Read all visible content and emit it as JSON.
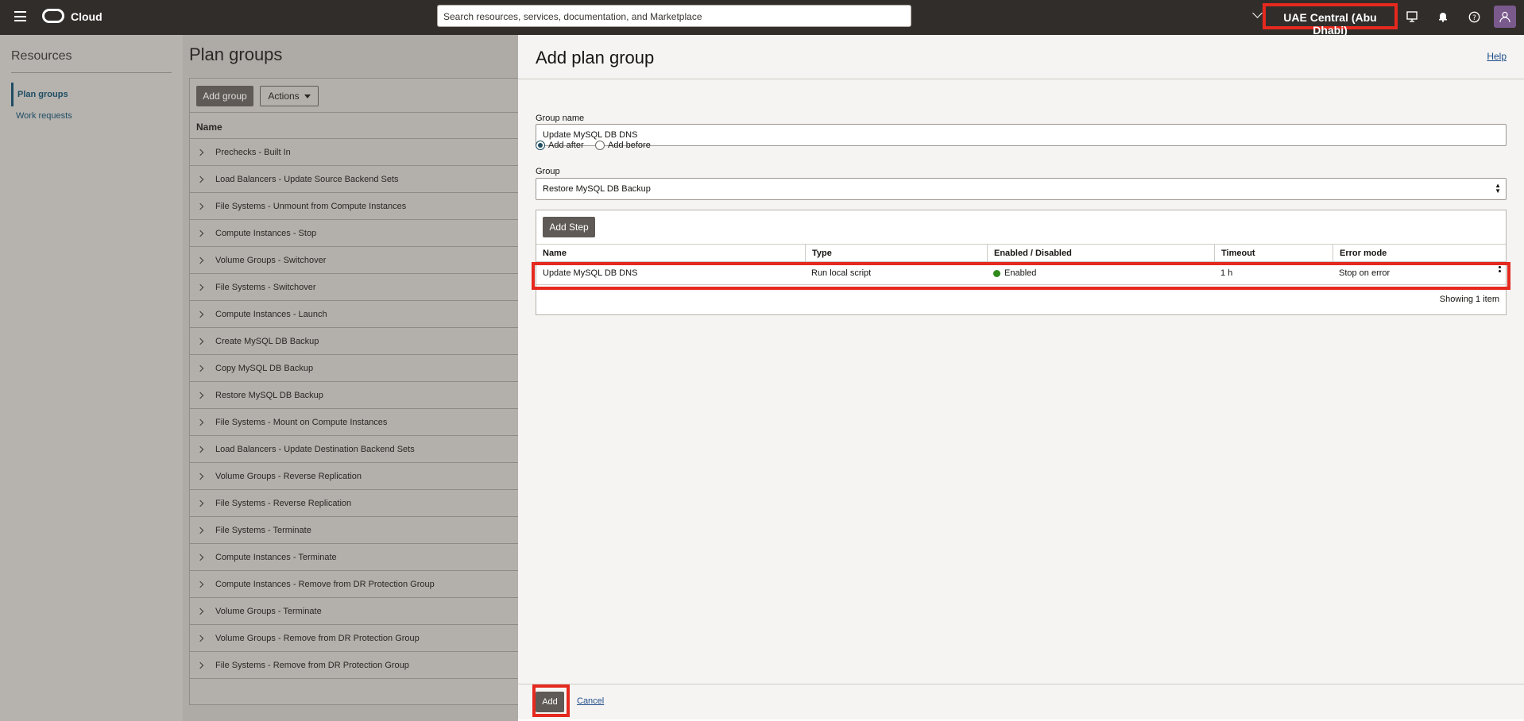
{
  "header": {
    "brand": "Cloud",
    "search_placeholder": "Search resources, services, documentation, and Marketplace",
    "region": "UAE Central (Abu Dhabi)",
    "icons": [
      "hamburger-icon",
      "cloud-logo-icon",
      "chevron-down-icon",
      "developer-tools-icon",
      "bell-icon",
      "help-icon",
      "user-avatar-icon"
    ]
  },
  "resources": {
    "title": "Resources",
    "items": [
      "Plan groups",
      "Work requests"
    ]
  },
  "plan_groups": {
    "title": "Plan groups",
    "add_label": "Add group",
    "actions_label": "Actions",
    "column": "Name",
    "rows": [
      "Prechecks - Built In",
      "Load Balancers - Update Source Backend Sets",
      "File Systems - Unmount from Compute Instances",
      "Compute Instances - Stop",
      "Volume Groups - Switchover",
      "File Systems - Switchover",
      "Compute Instances - Launch",
      "Create MySQL DB Backup",
      "Copy MySQL DB Backup",
      "Restore MySQL DB Backup",
      "File Systems - Mount on Compute Instances",
      "Load Balancers - Update Destination Backend Sets",
      "Volume Groups - Reverse Replication",
      "File Systems - Reverse Replication",
      "File Systems - Terminate",
      "Compute Instances - Terminate",
      "Compute Instances - Remove from DR Protection Group",
      "Volume Groups - Terminate",
      "Volume Groups - Remove from DR Protection Group",
      "File Systems - Remove from DR Protection Group"
    ]
  },
  "drawer": {
    "title": "Add plan group",
    "help": "Help",
    "group_name_label": "Group name",
    "group_name_value": "Update MySQL DB DNS",
    "radio_after": "Add after",
    "radio_before": "Add before",
    "group_label": "Group",
    "group_value": "Restore MySQL DB Backup",
    "add_step": "Add Step",
    "columns": [
      "Name",
      "Type",
      "Enabled / Disabled",
      "Timeout",
      "Error mode"
    ],
    "step": {
      "name": "Update MySQL DB DNS",
      "type": "Run local script",
      "status": "Enabled",
      "timeout": "1 h",
      "error_mode": "Stop on error"
    },
    "showing": "Showing 1 item",
    "add_button": "Add",
    "cancel": "Cancel"
  },
  "colors": {
    "header_bg": "#312d2a",
    "highlight": "#e5291f",
    "link": "#1f4d8a",
    "enabled_dot": "#2e8b1a"
  }
}
